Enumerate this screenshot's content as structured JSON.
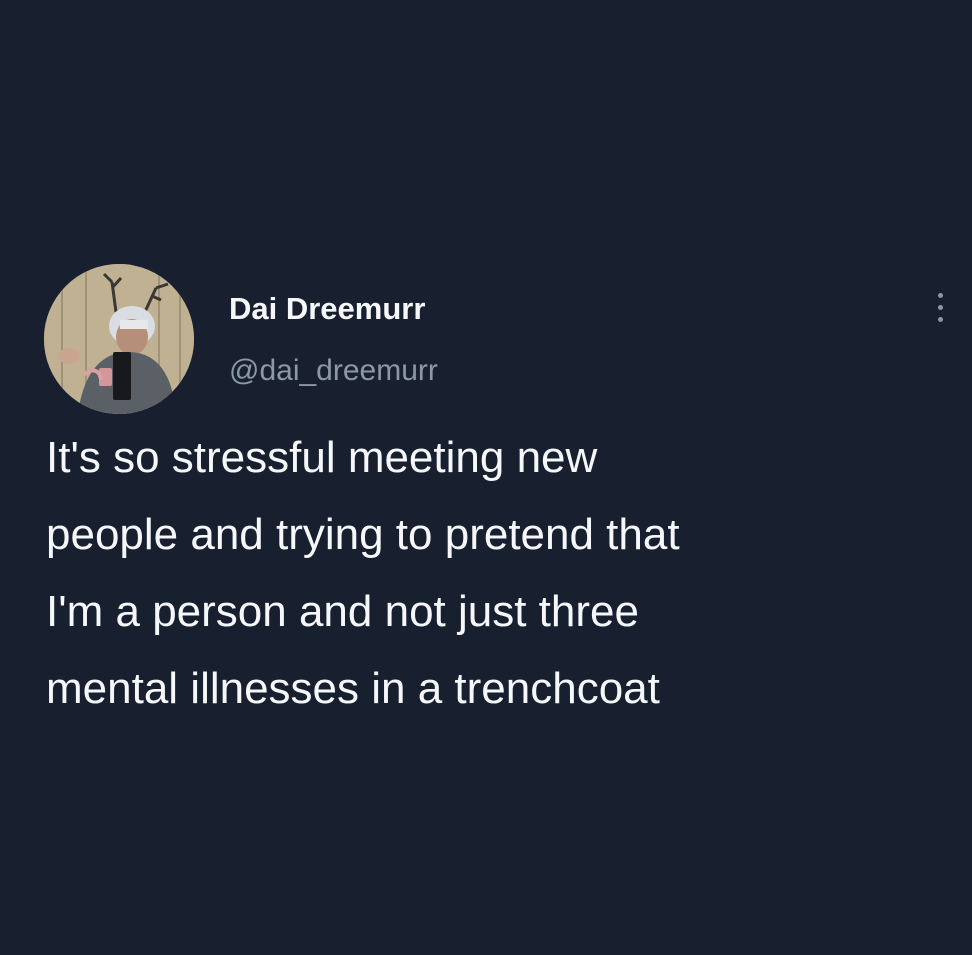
{
  "tweet": {
    "author": {
      "display_name": "Dai Dreemurr",
      "handle": "@dai_dreemurr",
      "avatar_icon": "profile-photo-avatar"
    },
    "text": "It's so stressful meeting new\npeople and trying to pretend that\nI'm a person and not just three\nmental illnesses in a trenchcoat",
    "more_icon": "vertical-ellipsis-icon"
  },
  "colors": {
    "background": "#182030",
    "primary_text": "#f5f7fa",
    "secondary_text": "#8b98a5"
  }
}
